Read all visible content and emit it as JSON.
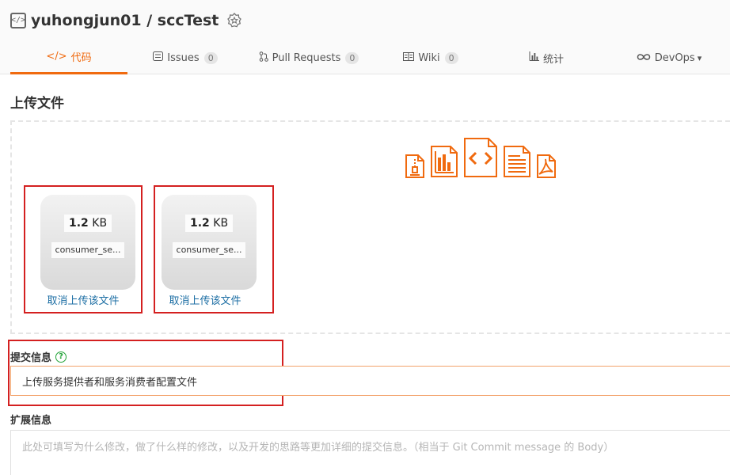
{
  "repo": {
    "owner": "yuhongjun01",
    "separator": " / ",
    "name": "sccTest"
  },
  "tabs": [
    {
      "label": "代码",
      "icon": "code-icon",
      "active": true
    },
    {
      "label": "Issues",
      "count": "0",
      "icon": "issues-icon"
    },
    {
      "label": "Pull Requests",
      "count": "0",
      "icon": "pull-request-icon"
    },
    {
      "label": "Wiki",
      "count": "0",
      "icon": "wiki-icon"
    },
    {
      "label": "统计",
      "icon": "chart-icon"
    },
    {
      "label": "DevOps",
      "icon": "devops-icon",
      "caret": "▾"
    }
  ],
  "upload": {
    "title": "上传文件",
    "file_type_icons": [
      "zip-file-icon",
      "chart-file-icon",
      "code-file-icon",
      "text-file-icon",
      "pdf-file-icon"
    ],
    "files": [
      {
        "size_value": "1.2",
        "size_unit": " KB",
        "name": "consumer_se...",
        "cancel_label": "取消上传该文件"
      },
      {
        "size_value": "1.2",
        "size_unit": " KB",
        "name": "consumer_se...",
        "cancel_label": "取消上传该文件"
      }
    ]
  },
  "commit": {
    "label": "提交信息",
    "help": "?",
    "value": "上传服务提供者和服务消费者配置文件"
  },
  "extended": {
    "label": "扩展信息",
    "placeholder": "此处可填写为什么修改，做了什么样的修改，以及开发的思路等更加详细的提交信息。（相当于 Git Commit message 的 Body）"
  },
  "colors": {
    "accent": "#f06a0f",
    "link": "#1c6ea4",
    "highlight_border": "#d42020",
    "help": "#21a336"
  }
}
